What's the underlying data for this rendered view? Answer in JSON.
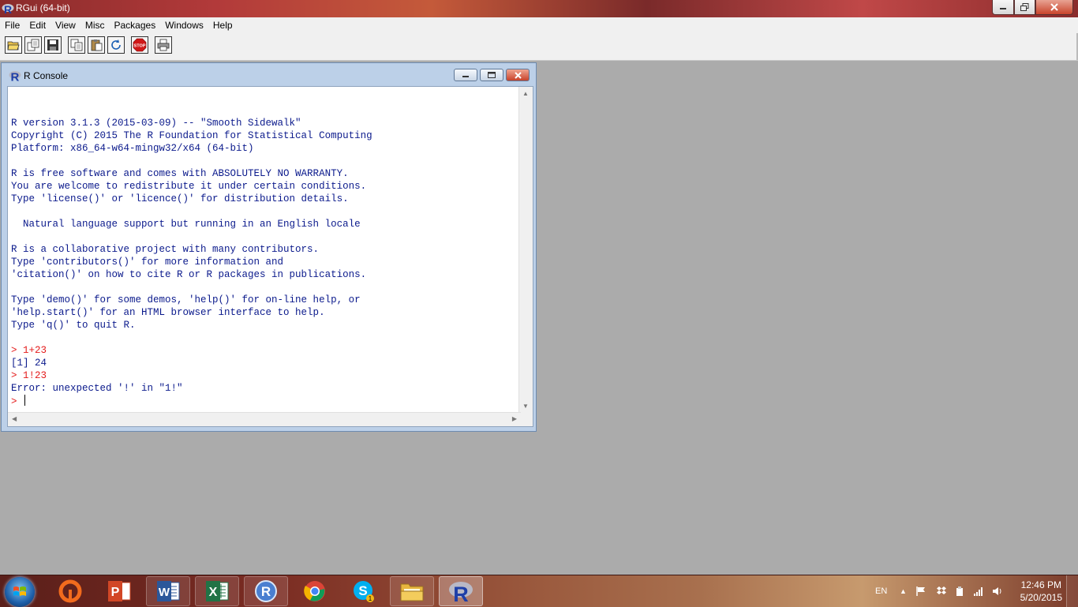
{
  "app": {
    "title": "RGui (64-bit)",
    "menu": [
      "File",
      "Edit",
      "View",
      "Misc",
      "Packages",
      "Windows",
      "Help"
    ],
    "toolbar_icons": [
      "open-script-icon",
      "load-workspace-icon",
      "save-icon",
      "copy-icon",
      "paste-icon",
      "copy-paste-icon",
      "stop-icon",
      "print-icon"
    ],
    "stop_label": "STOP"
  },
  "console": {
    "title": "R Console",
    "lines": [
      {
        "text": "",
        "type": "out"
      },
      {
        "text": "R version 3.1.3 (2015-03-09) -- \"Smooth Sidewalk\"",
        "type": "out"
      },
      {
        "text": "Copyright (C) 2015 The R Foundation for Statistical Computing",
        "type": "out"
      },
      {
        "text": "Platform: x86_64-w64-mingw32/x64 (64-bit)",
        "type": "out"
      },
      {
        "text": "",
        "type": "out"
      },
      {
        "text": "R is free software and comes with ABSOLUTELY NO WARRANTY.",
        "type": "out"
      },
      {
        "text": "You are welcome to redistribute it under certain conditions.",
        "type": "out"
      },
      {
        "text": "Type 'license()' or 'licence()' for distribution details.",
        "type": "out"
      },
      {
        "text": "",
        "type": "out"
      },
      {
        "text": "  Natural language support but running in an English locale",
        "type": "out"
      },
      {
        "text": "",
        "type": "out"
      },
      {
        "text": "R is a collaborative project with many contributors.",
        "type": "out"
      },
      {
        "text": "Type 'contributors()' for more information and",
        "type": "out"
      },
      {
        "text": "'citation()' on how to cite R or R packages in publications.",
        "type": "out"
      },
      {
        "text": "",
        "type": "out"
      },
      {
        "text": "Type 'demo()' for some demos, 'help()' for on-line help, or",
        "type": "out"
      },
      {
        "text": "'help.start()' for an HTML browser interface to help.",
        "type": "out"
      },
      {
        "text": "Type 'q()' to quit R.",
        "type": "out"
      },
      {
        "text": "",
        "type": "out"
      },
      {
        "text": "> 1+23",
        "type": "cmd"
      },
      {
        "text": "[1] 24",
        "type": "out"
      },
      {
        "text": "> 1!23",
        "type": "cmd"
      },
      {
        "text": "Error: unexpected '!' in \"1!\"",
        "type": "out"
      }
    ],
    "prompt": "> "
  },
  "taskbar": {
    "apps": [
      {
        "name": "origin-icon",
        "label": ""
      },
      {
        "name": "powerpoint-icon",
        "label": "P"
      },
      {
        "name": "word-icon",
        "label": "W"
      },
      {
        "name": "excel-icon",
        "label": "X"
      },
      {
        "name": "r-icon",
        "label": "R"
      },
      {
        "name": "chrome-icon",
        "label": ""
      },
      {
        "name": "skype-icon",
        "label": "S"
      },
      {
        "name": "explorer-icon",
        "label": ""
      },
      {
        "name": "rgui-icon",
        "label": "R"
      }
    ],
    "skype_badge": "1",
    "language": "EN",
    "time": "12:46 PM",
    "date": "5/20/2015"
  },
  "colors": {
    "output": "#0b1a8c",
    "command": "#e41b1b",
    "workspace": "#ababab"
  }
}
